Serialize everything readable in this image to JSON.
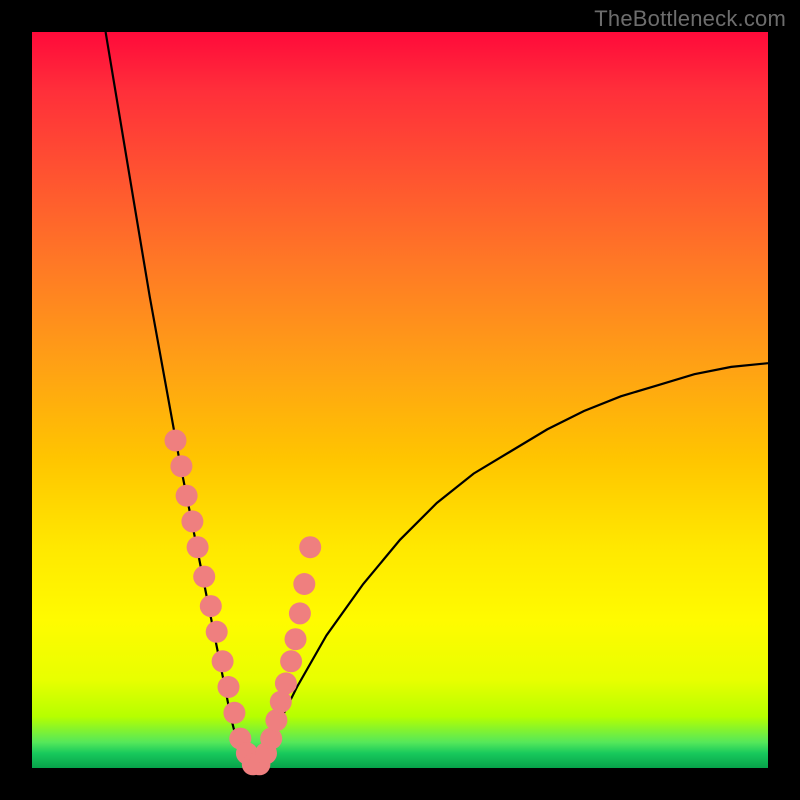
{
  "watermark": "TheBottleneck.com",
  "colors": {
    "frame": "#000000",
    "curve": "#000000",
    "point_fill": "#ef7f7f"
  },
  "chart_data": {
    "type": "line",
    "title": "",
    "xlabel": "",
    "ylabel": "",
    "xlim": [
      0,
      100
    ],
    "ylim": [
      0,
      100
    ],
    "grid": false,
    "legend": false,
    "annotations": [
      "TheBottleneck.com"
    ],
    "curve_note": "V-shaped curve; minimum near x≈28, y≈0; long concave right arm rising to ~55 at x=100",
    "series": [
      {
        "name": "curve",
        "x": [
          10,
          12,
          14,
          16,
          18,
          20,
          22,
          24,
          26,
          27,
          28,
          29,
          30,
          31,
          32,
          34,
          36,
          40,
          45,
          50,
          55,
          60,
          65,
          70,
          75,
          80,
          85,
          90,
          95,
          100
        ],
        "y": [
          100,
          88,
          76,
          64,
          53,
          42,
          32,
          22,
          12,
          7,
          3,
          1,
          0,
          1,
          3,
          7,
          11,
          18,
          25,
          31,
          36,
          40,
          43,
          46,
          48.5,
          50.5,
          52,
          53.5,
          54.5,
          55
        ]
      }
    ],
    "scatter_points": {
      "name": "highlighted-dots",
      "x": [
        19.5,
        20.3,
        21.0,
        21.8,
        22.5,
        23.4,
        24.3,
        25.1,
        25.9,
        26.7,
        27.5,
        28.3,
        29.2,
        30.0,
        30.9,
        31.8,
        32.5,
        33.2,
        33.8,
        34.5,
        35.2,
        35.8,
        36.4,
        37.0,
        37.8
      ],
      "y": [
        44.5,
        41.0,
        37.0,
        33.5,
        30.0,
        26.0,
        22.0,
        18.5,
        14.5,
        11.0,
        7.5,
        4.0,
        2.0,
        0.5,
        0.5,
        2.0,
        4.0,
        6.5,
        9.0,
        11.5,
        14.5,
        17.5,
        21.0,
        25.0,
        30.0
      ]
    }
  }
}
